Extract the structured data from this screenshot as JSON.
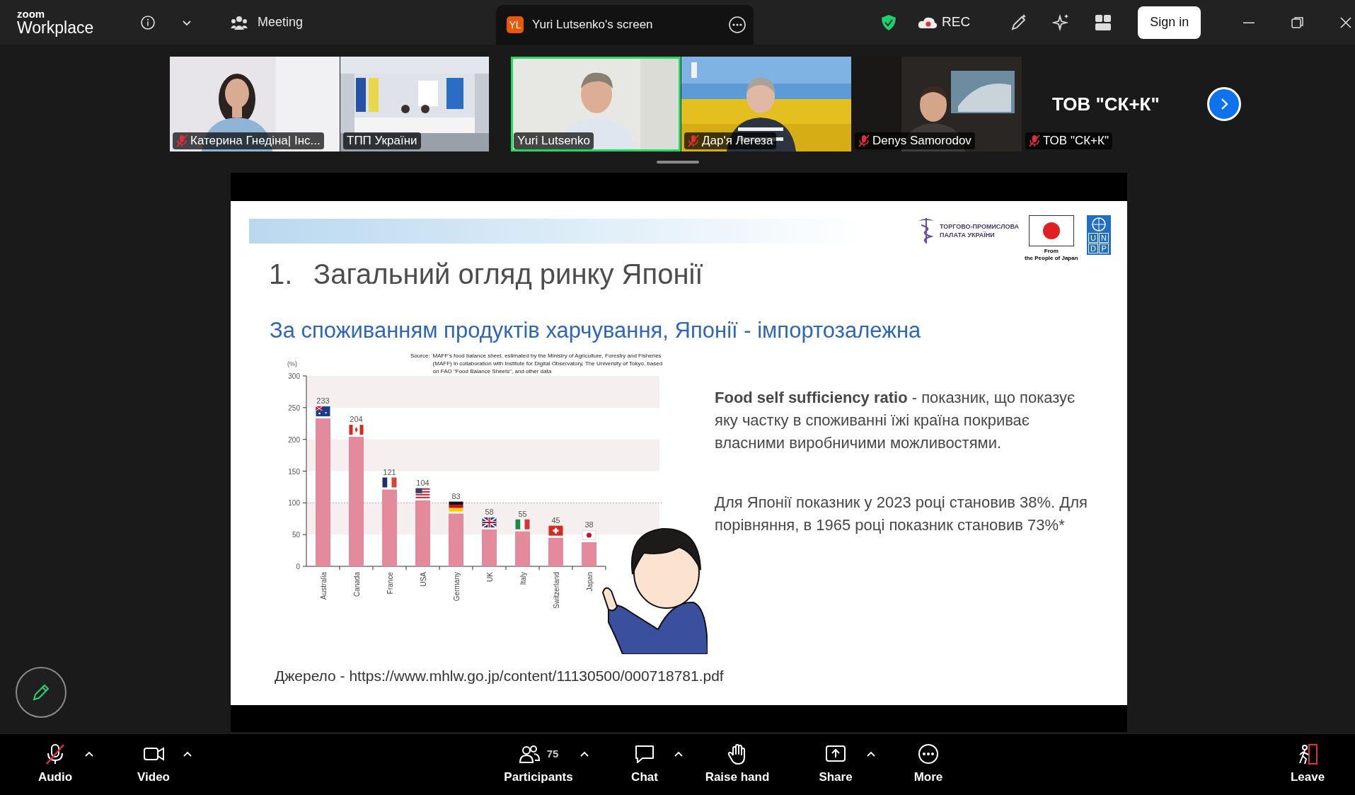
{
  "top_bar": {
    "logo_small": "zoom",
    "logo_main": "Workplace",
    "meeting_tab": "Meeting",
    "share_tab": {
      "badge": "YL",
      "title": "Yuri Lutsenko's screen"
    },
    "rec_label": "REC",
    "sign_in": "Sign in"
  },
  "participants": [
    {
      "name": "Катерина Гнедіна| Інс...",
      "kind": "video",
      "muted": true,
      "speaking": false
    },
    {
      "name": "ТПП України",
      "kind": "video",
      "muted": false,
      "speaking": false
    },
    {
      "name": "Yuri Lutsenko",
      "kind": "video",
      "muted": false,
      "speaking": true
    },
    {
      "name": "Дар'я Легеза",
      "kind": "video",
      "muted": true,
      "speaking": false
    },
    {
      "name": "Denys Samorodov",
      "kind": "video",
      "muted": true,
      "speaking": false
    },
    {
      "name": "ТОВ \"СК+К\"",
      "kind": "text",
      "display_text": "ТОВ \"СК+К\"",
      "muted": true,
      "speaking": false
    }
  ],
  "slide": {
    "logo_tpp_lines": [
      "ТОРГОВО-ПРОМИСЛОВА",
      "ПАЛАТА УКРАЇНИ"
    ],
    "logo_japan_lines": [
      "From",
      "the People of Japan"
    ],
    "undp_letters": [
      "U",
      "N",
      "D",
      "P"
    ],
    "title_number": "1.",
    "title": "Загальний огляд ринку Японії",
    "subtitle": "За споживанням продуктів харчування, Японії - імпортозалежна",
    "chart_source_label": "Source:",
    "chart_source": "MAFF's food balance sheet, estimated by the Ministry of Agriculture, Forestry and Fisheries (MAFF) in collaboration with Institute for Digital Observatory, The University of Tokyo, based on FAO \"Food Balance Sheets\", and other data",
    "chart_data": {
      "type": "bar",
      "ylabel": "(%)",
      "categories": [
        "Australia",
        "Canada",
        "France",
        "USA",
        "Germany",
        "UK",
        "Italy",
        "Switzerland",
        "Japan"
      ],
      "series": [
        {
          "color": "#e38a9c",
          "values": [
            233,
            204,
            121,
            104,
            83,
            58,
            55,
            45,
            38
          ]
        }
      ],
      "ylim": [
        0,
        300
      ],
      "yticks": [
        0,
        50,
        100,
        150,
        200,
        250,
        300
      ],
      "data_labels": true
    },
    "paragraphs": [
      "**Food self sufficiency ratio** - показник, що показує яку частку в споживанні їжі країна покриває власними виробничими можливостями.",
      "Для Японії показник у 2023 році становив 38%. Для порівняння, в 1965 році показник становив 73%*"
    ],
    "source_line": "Джерело - https://www.mhlw.go.jp/content/11130500/000718781.pdf"
  },
  "toolbar": [
    {
      "kind": "audio",
      "label": "Audio",
      "muted": true,
      "caret": true
    },
    {
      "kind": "video",
      "label": "Video",
      "caret": true
    },
    {
      "kind": "participants",
      "label": "Participants",
      "count": "75",
      "caret": true
    },
    {
      "kind": "chat",
      "label": "Chat",
      "caret": true
    },
    {
      "kind": "hand",
      "label": "Raise hand",
      "caret": false
    },
    {
      "kind": "share",
      "label": "Share",
      "caret": true
    },
    {
      "kind": "more",
      "label": "More",
      "caret": false
    },
    {
      "kind": "leave",
      "label": "Leave",
      "caret": false
    }
  ]
}
